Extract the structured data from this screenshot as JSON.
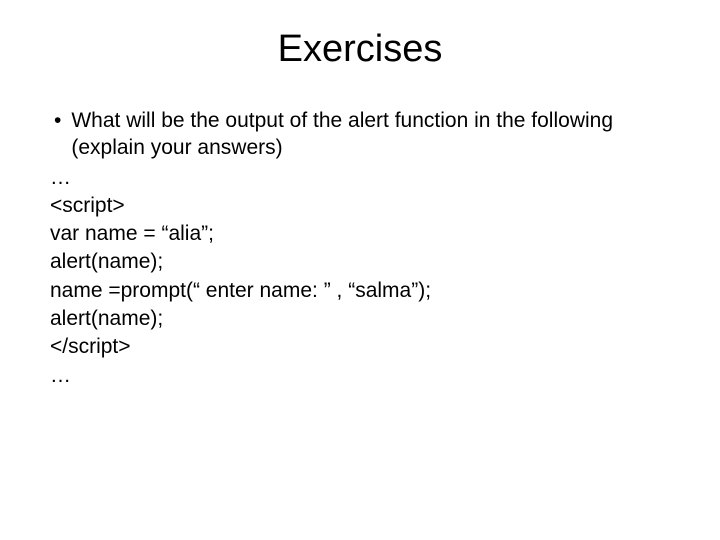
{
  "slide": {
    "title": "Exercises",
    "bullet": "•",
    "question": "What will be the output of the alert function in the following (explain your answers)",
    "lines": {
      "l0": "…",
      "l1": "<script>",
      "l2": "var name = “alia”;",
      "l3": "alert(name);",
      "l4": "name =prompt(“ enter name: ” , “salma”);",
      "l5": "alert(name);",
      "l6": "</script>",
      "l7": "…"
    }
  }
}
